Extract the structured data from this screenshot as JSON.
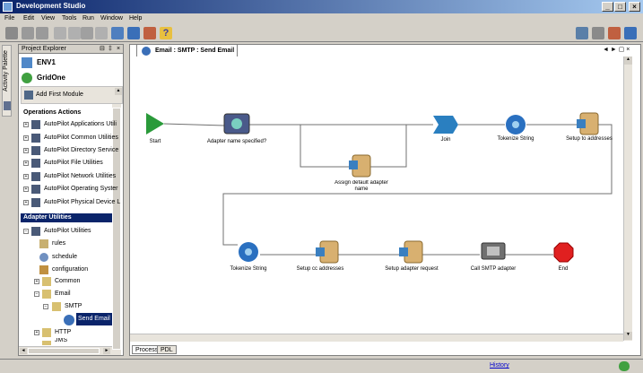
{
  "window": {
    "title": "Development Studio"
  },
  "menu": [
    "File",
    "Edit",
    "View",
    "Tools",
    "Run",
    "Window",
    "Help"
  ],
  "activity_palette": "Activity Palette",
  "project_explorer": {
    "title": "Project Explorer",
    "env": "ENV1",
    "grid": "GridOne",
    "add_module": "Add First Module",
    "operations_title": "Operations Actions",
    "operations": [
      "AutoPilot Applications Utili",
      "AutoPilot Common Utilities",
      "AutoPilot Directory Service",
      "AutoPilot File Utilities",
      "AutoPilot Network Utilities",
      "AutoPilot Operating Syster",
      "AutoPilot Physical Device L"
    ],
    "adapter_title": "Adapter Utilities",
    "adapter_root": "AutoPilot Utilities",
    "adapter_items": [
      "rules",
      "schedule",
      "configuration",
      "Common",
      "Email",
      "SMTP",
      "Send Email",
      "HTTP",
      "JMS"
    ]
  },
  "editor": {
    "tab": "Email : SMTP : Send Email",
    "bottom_tabs": [
      "Process",
      "PDL"
    ]
  },
  "workflow": {
    "nodes": [
      "Start",
      "Adapter name specified?",
      "Assign default adapter name",
      "Join",
      "Tokenize String",
      "Setup to addresses",
      "Tokenize String",
      "Setup cc addresses",
      "Setup adapter request",
      "Call SMTP adapter",
      "End"
    ]
  },
  "status": {
    "link": "History"
  }
}
